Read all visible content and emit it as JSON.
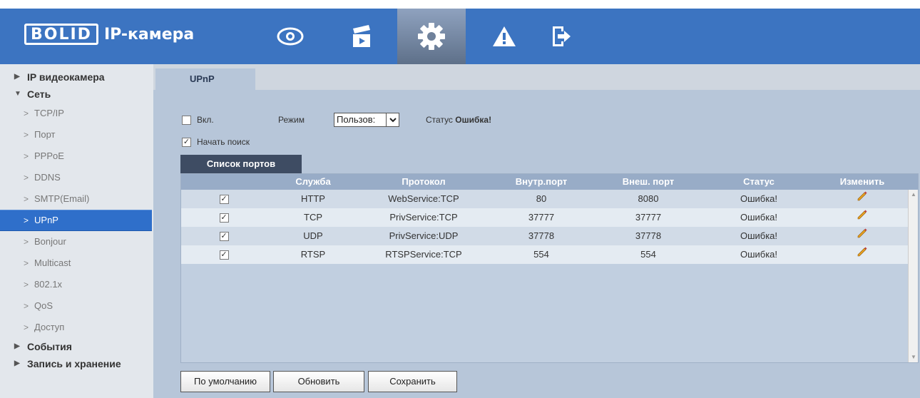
{
  "header": {
    "logo": "BOLID",
    "title": "IP-камера",
    "nav_icons": [
      "eye-icon",
      "clapperboard-icon",
      "gear-icon",
      "warning-icon",
      "logout-icon"
    ],
    "colors": {
      "bar": "#3c74c1",
      "active": "#5e7089"
    }
  },
  "sidebar": {
    "groups": [
      {
        "label": "IP видеокамера",
        "expanded": false
      },
      {
        "label": "Сеть",
        "expanded": true
      },
      {
        "label": "События",
        "expanded": false
      },
      {
        "label": "Запись и хранение",
        "expanded": false
      }
    ],
    "items": [
      "TCP/IP",
      "Порт",
      "PPPoE",
      "DDNS",
      "SMTP(Email)",
      "UPnP",
      "Bonjour",
      "Multicast",
      "802.1x",
      "QoS",
      "Доступ"
    ],
    "active_item": "UPnP"
  },
  "tab": {
    "label": "UPnP"
  },
  "form": {
    "enable_label": "Вкл.",
    "enable_checked": false,
    "mode_label": "Режим",
    "mode_value": "Пользов:",
    "status_label": "Статус",
    "status_value": "Ошибка!",
    "search_label": "Начать поиск",
    "search_checked": true
  },
  "port_list": {
    "tab_label": "Список портов",
    "columns": [
      "Служба",
      "Протокол",
      "Внутр.порт",
      "Внеш. порт",
      "Статус",
      "Изменить"
    ],
    "rows": [
      {
        "checked": true,
        "service": "HTTP",
        "protocol": "WebService:TCP",
        "internal": "80",
        "external": "8080",
        "status": "Ошибка!"
      },
      {
        "checked": true,
        "service": "TCP",
        "protocol": "PrivService:TCP",
        "internal": "37777",
        "external": "37777",
        "status": "Ошибка!"
      },
      {
        "checked": true,
        "service": "UDP",
        "protocol": "PrivService:UDP",
        "internal": "37778",
        "external": "37778",
        "status": "Ошибка!"
      },
      {
        "checked": true,
        "service": "RTSP",
        "protocol": "RTSPService:TCP",
        "internal": "554",
        "external": "554",
        "status": "Ошибка!"
      }
    ]
  },
  "buttons": {
    "default": "По умолчанию",
    "refresh": "Обновить",
    "save": "Сохранить"
  }
}
